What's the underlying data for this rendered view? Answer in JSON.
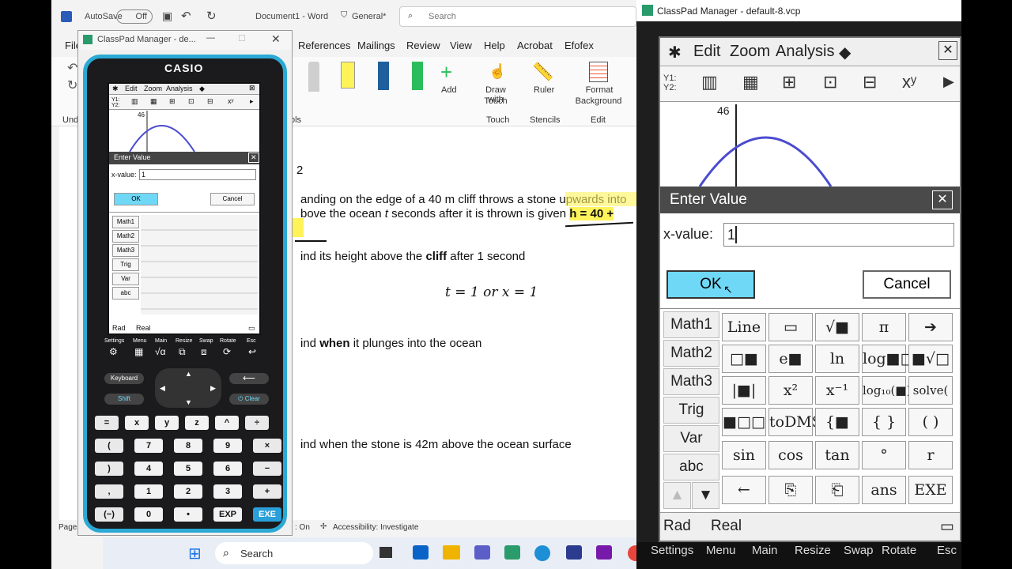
{
  "word": {
    "autosave_label": "AutoSave",
    "autosave_state": "Off",
    "doc_name": "Document1 - Word",
    "sensitivity": "General*",
    "search_placeholder": "Search",
    "tabs": [
      "File",
      "References",
      "Mailings",
      "Review",
      "View",
      "Help",
      "Acrobat",
      "Efofex"
    ],
    "ribbon": {
      "add_label": "Add",
      "draw_touch_line1": "Draw with",
      "draw_touch_line2": "Touch",
      "ruler": "Ruler",
      "format_bg_line1": "Format",
      "format_bg_line2": "Background",
      "group_touch": "Touch",
      "group_stencils": "Stencils",
      "group_edit": "Edit",
      "group_tools": "ols",
      "group_undo": "Und"
    },
    "doc": {
      "q_num": "2",
      "line1": "anding on the edge of a 40 m cliff throws a stone upwards into",
      "line1_hl": "upwards into",
      "line2_a": "bove the ocean ",
      "line2_t": "t",
      "line2_b": " seconds after it is thrown is given ",
      "line2_hl": "h = 40 +",
      "qa_a": "ind its height above the ",
      "qa_b": "cliff",
      "qa_c": " after 1 second",
      "handwriting": "t = 1  or  x = 1",
      "qb_a": "ind ",
      "qb_b": "when",
      "qb_c": " it plunges into the ocean",
      "qc": "ind when the stone is 42m above the ocean surface"
    },
    "status": {
      "page": "Page",
      "on": ": On",
      "accessibility": "Accessibility: Investigate"
    },
    "taskbar_search": "Search"
  },
  "small": {
    "title": "ClassPad Manager - de...",
    "brand": "CASIO",
    "menu": [
      "Edit",
      "Zoom",
      "Analysis",
      "◆"
    ],
    "graph_label": "46",
    "dialog_title": "Enter Value",
    "field_label": "x-value:",
    "field_value": "1",
    "ok": "OK",
    "cancel": "Cancel",
    "tabs": [
      "Math1",
      "Math2",
      "Math3",
      "Trig",
      "Var",
      "abc"
    ],
    "status_left": "Rad",
    "status_mid": "Real",
    "bottom_icons": [
      "Settings",
      "Menu",
      "Main",
      "Resize",
      "Swap",
      "Rotate",
      "Esc"
    ],
    "keyboard": "Keyboard",
    "shift": "Shift",
    "clear": "Clear",
    "keys": [
      [
        "=",
        "x",
        "y",
        "z",
        "^",
        "÷"
      ],
      [
        "(",
        "7",
        "8",
        "9",
        "×"
      ],
      [
        ")",
        "4",
        "5",
        "6",
        "−"
      ],
      [
        ",",
        "1",
        "2",
        "3",
        "+"
      ],
      [
        "(−)",
        "0",
        "•",
        "EXP",
        "EXE"
      ]
    ]
  },
  "big": {
    "title": "ClassPad Manager - default-8.vcp",
    "menu": [
      "Edit",
      "Zoom",
      "Analysis",
      "◆"
    ],
    "graph_label": "46",
    "dialog_title": "Enter Value",
    "field_label": "x-value:",
    "field_value": "1",
    "ok": "OK",
    "cancel": "Cancel",
    "tabs": [
      "Math1",
      "Math2",
      "Math3",
      "Trig",
      "Var",
      "abc"
    ],
    "keys": [
      [
        "Line",
        "▭",
        "√■",
        "π",
        "➔"
      ],
      [
        "□■",
        "e■",
        "ln",
        "log■□",
        "■√□"
      ],
      [
        "|■|",
        "x²",
        "x⁻¹",
        "log₁₀(■)",
        "solve("
      ],
      [
        "■□□",
        "toDMS",
        "{■",
        "{ }",
        "( )"
      ],
      [
        "sin",
        "cos",
        "tan",
        "°",
        "r"
      ],
      [
        "←",
        "⎘",
        "⎗",
        "ans",
        "EXE"
      ]
    ],
    "status_left": "Rad",
    "status_mid": "Real",
    "bottom_labels": [
      "Settings",
      "Menu",
      "Main",
      "Resize",
      "Swap",
      "Rotate",
      "Esc"
    ]
  }
}
